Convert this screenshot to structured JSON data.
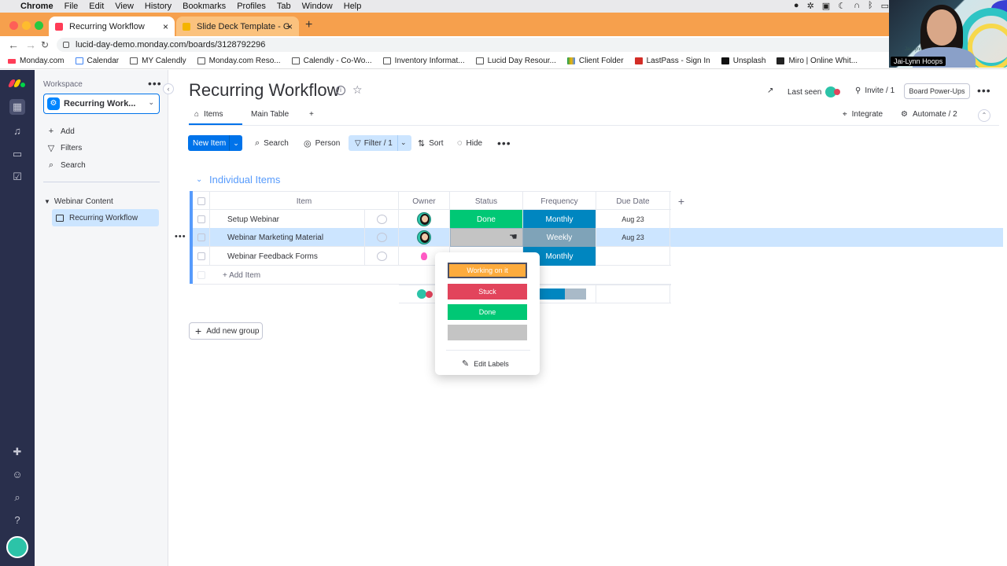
{
  "menubar": {
    "app": "Chrome",
    "items": [
      "File",
      "Edit",
      "View",
      "History",
      "Bookmarks",
      "Profiles",
      "Tab",
      "Window",
      "Help"
    ]
  },
  "browser": {
    "tabs": [
      {
        "title": "Recurring Workflow"
      },
      {
        "title": "Slide Deck Template - Google"
      }
    ],
    "url": "lucid-day-demo.monday.com/boards/3128792296",
    "bookmarks": [
      "Monday.com",
      "Calendar",
      "MY Calendly",
      "Monday.com Reso...",
      "Calendly - Co-Wo...",
      "Inventory Informat...",
      "Lucid Day Resour...",
      "Client Folder",
      "LastPass - Sign In",
      "Unsplash",
      "Miro | Online Whit..."
    ]
  },
  "video": {
    "name": "Jai-Lynn Hoops",
    "small_label": "Jai-Lynn"
  },
  "sidebar": {
    "workspace_label": "Workspace",
    "workspace_name": "Recurring Work...",
    "actions": [
      {
        "label": "Add",
        "icon": "plus-icon"
      },
      {
        "label": "Filters",
        "icon": "filter-icon"
      },
      {
        "label": "Search",
        "icon": "search-icon"
      }
    ],
    "folder": "Webinar Content",
    "board": "Recurring Workflow"
  },
  "header": {
    "title": "Recurring Workflow",
    "last_seen": "Last seen",
    "invite": "Invite / 1",
    "power_ups": "Board Power-Ups"
  },
  "views": {
    "tabs": [
      "Items",
      "Main Table"
    ],
    "add": "+",
    "integrate": "Integrate",
    "automate": "Automate / 2"
  },
  "toolbar": {
    "new_item": "New Item",
    "search": "Search",
    "person": "Person",
    "filter": "Filter / 1",
    "sort": "Sort",
    "hide": "Hide"
  },
  "group": {
    "title": "Individual Items",
    "columns": {
      "item": "Item",
      "owner": "Owner",
      "status": "Status",
      "frequency": "Frequency",
      "due_date": "Due Date"
    },
    "rows": [
      {
        "name": "Setup Webinar",
        "status": "Done",
        "frequency": "Monthly",
        "due": "Aug 23"
      },
      {
        "name": "Webinar Marketing Material",
        "status": "",
        "frequency": "Weekly",
        "due": "Aug 23"
      },
      {
        "name": "Webinar Feedback Forms",
        "status": "",
        "frequency": "Monthly",
        "due": ""
      }
    ],
    "add_item": "+ Add Item"
  },
  "status_dropdown": {
    "labels": [
      {
        "text": "Working on it",
        "color": "#fdab3d"
      },
      {
        "text": "Stuck",
        "color": "#e2445c"
      },
      {
        "text": "Done",
        "color": "#00c875"
      },
      {
        "text": "",
        "color": "#c4c4c4"
      }
    ],
    "edit_labels": "Edit Labels"
  },
  "add_group": "Add new group",
  "colors": {
    "accent": "#0073ea",
    "group": "#579bfc",
    "done": "#00c875",
    "frequency": "#0086c0",
    "rail": "#292f4c"
  }
}
